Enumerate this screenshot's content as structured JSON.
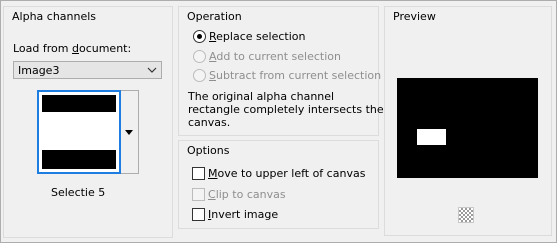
{
  "alpha_channels": {
    "title": "Alpha channels",
    "load_from_label_prefix": "Load from ",
    "load_from_label_underlined": "d",
    "load_from_label_suffix": "ocument:",
    "document_value": "Image3",
    "selection_name": "Selectie 5"
  },
  "operation": {
    "title": "Operation",
    "options": [
      {
        "underlined": "R",
        "rest": "eplace selection",
        "selected": true,
        "enabled": true
      },
      {
        "underlined": "A",
        "rest": "dd to current selection",
        "selected": false,
        "enabled": false
      },
      {
        "underlined": "S",
        "rest": "ubtract from current selection",
        "selected": false,
        "enabled": false
      }
    ],
    "message_line1": "The original alpha channel",
    "message_line2": "rectangle completely intersects the",
    "message_line3": "canvas."
  },
  "options": {
    "title": "Options",
    "items": [
      {
        "underlined": "M",
        "rest": "ove to upper left of canvas",
        "checked": false,
        "enabled": true
      },
      {
        "underlined": "C",
        "rest": "lip to canvas",
        "checked": false,
        "enabled": false
      },
      {
        "underlined": "I",
        "rest": "nvert image",
        "checked": false,
        "enabled": true
      }
    ]
  },
  "preview": {
    "title": "Preview",
    "checker_icon": "transparency-checker-icon"
  }
}
